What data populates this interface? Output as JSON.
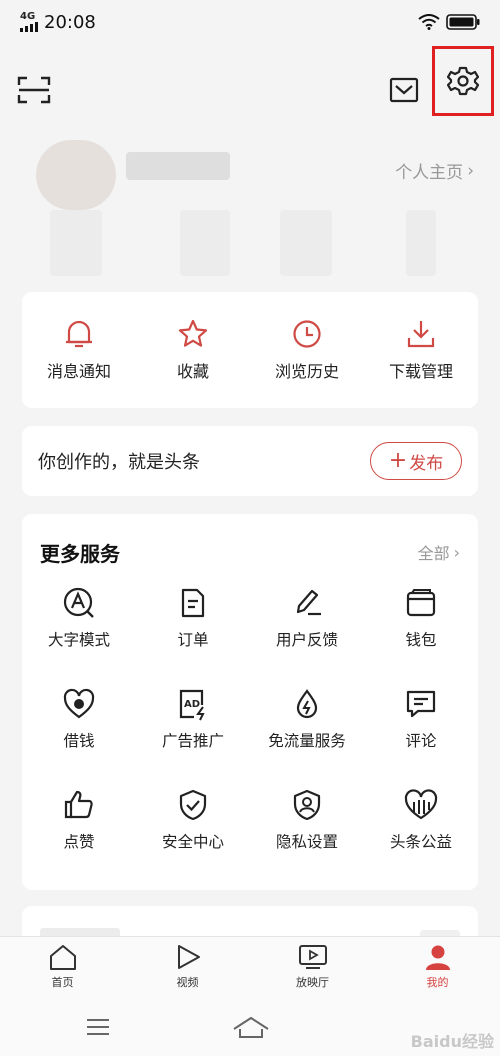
{
  "status": {
    "network": "4G",
    "time": "20:08",
    "wifi_icon": "wifi-icon",
    "battery_icon": "battery-icon"
  },
  "topbar": {
    "scan_icon": "scan-icon",
    "mail_icon": "mail-icon",
    "settings_icon": "settings-icon",
    "highlight_color": "#e02020"
  },
  "profile": {
    "link_label": "个人主页"
  },
  "quick_actions": [
    {
      "label": "消息通知",
      "icon": "bell-icon"
    },
    {
      "label": "收藏",
      "icon": "star-icon"
    },
    {
      "label": "浏览历史",
      "icon": "clock-icon"
    },
    {
      "label": "下载管理",
      "icon": "download-icon"
    }
  ],
  "publish": {
    "text": "你创作的，就是头条",
    "button_label": "发布"
  },
  "services": {
    "title": "更多服务",
    "all_label": "全部",
    "items": [
      {
        "label": "大字模式",
        "icon": "large-font-icon"
      },
      {
        "label": "订单",
        "icon": "order-icon"
      },
      {
        "label": "用户反馈",
        "icon": "feedback-icon"
      },
      {
        "label": "钱包",
        "icon": "wallet-icon"
      },
      {
        "label": "借钱",
        "icon": "loan-icon"
      },
      {
        "label": "广告推广",
        "icon": "ad-icon"
      },
      {
        "label": "免流量服务",
        "icon": "data-free-icon"
      },
      {
        "label": "评论",
        "icon": "comment-icon"
      },
      {
        "label": "点赞",
        "icon": "like-icon"
      },
      {
        "label": "安全中心",
        "icon": "shield-icon"
      },
      {
        "label": "隐私设置",
        "icon": "privacy-icon"
      },
      {
        "label": "头条公益",
        "icon": "charity-icon"
      }
    ]
  },
  "tabs": [
    {
      "label": "首页",
      "icon": "home-icon",
      "active": false
    },
    {
      "label": "视频",
      "icon": "play-icon",
      "active": false
    },
    {
      "label": "放映厅",
      "icon": "tv-icon",
      "active": false
    },
    {
      "label": "我的",
      "icon": "person-icon",
      "active": true
    }
  ],
  "navbar": {
    "menu_icon": "menu-icon",
    "home_icon": "home-gesture-icon"
  },
  "watermark": "Baidu经验",
  "colors": {
    "accent": "#d6423f",
    "icon_red": "#d04a45"
  }
}
